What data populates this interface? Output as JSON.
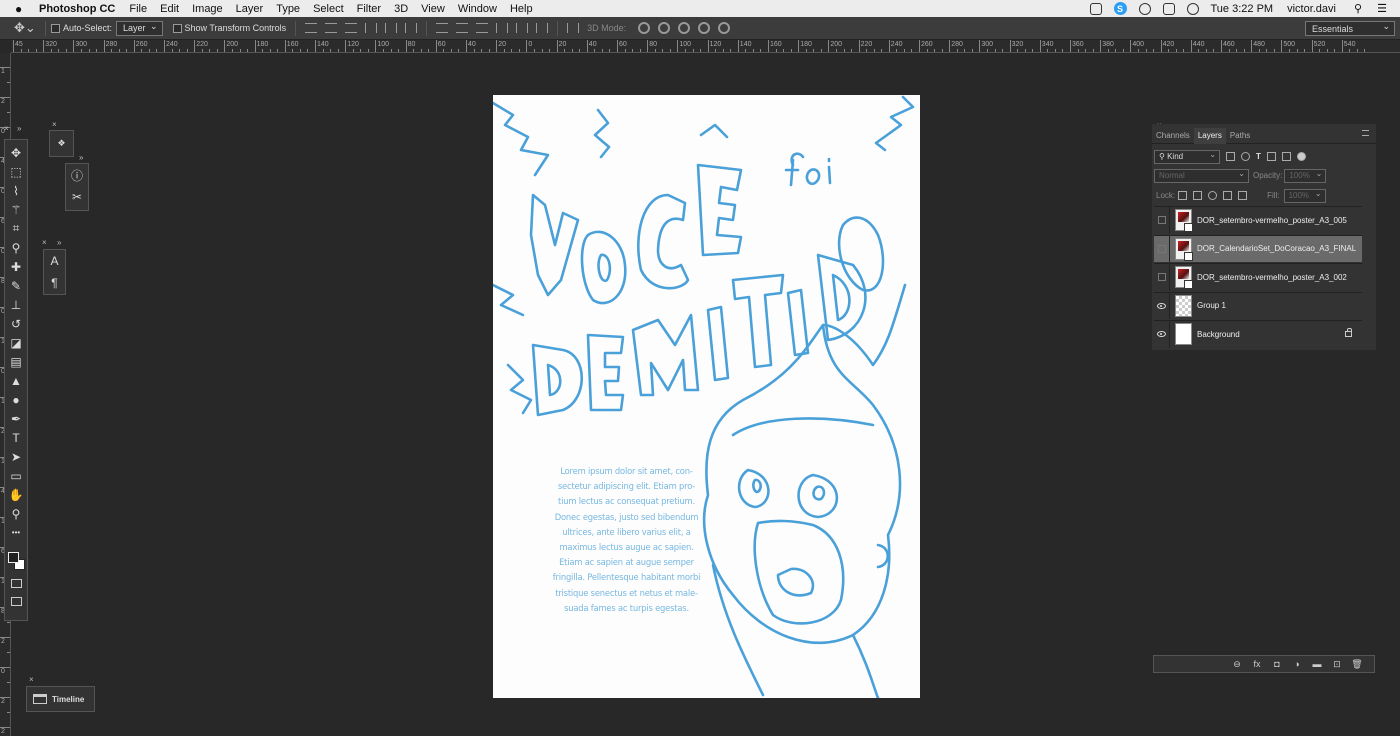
{
  "menubar": {
    "app_name": "Photoshop CC",
    "menus": [
      "File",
      "Edit",
      "Image",
      "Layer",
      "Type",
      "Select",
      "Filter",
      "3D",
      "View",
      "Window",
      "Help"
    ],
    "skype_badge": "S",
    "clock": "Tue 3:22 PM",
    "user": "victor.davi"
  },
  "options": {
    "auto_select_label": "Auto-Select:",
    "auto_select_value": "Layer",
    "show_transform_label": "Show Transform Controls",
    "mode_3d_label": "3D Mode:",
    "workspace": "Essentials"
  },
  "rulers": {
    "top_labels": [
      "45",
      "320",
      "300",
      "280",
      "260",
      "240",
      "220",
      "200",
      "180",
      "160",
      "140",
      "120",
      "100",
      "80",
      "60",
      "40",
      "20",
      "0",
      "20",
      "40",
      "60",
      "80",
      "100",
      "120",
      "140",
      "160",
      "180",
      "200",
      "220",
      "240",
      "260",
      "280",
      "300",
      "320",
      "340",
      "360",
      "380",
      "400",
      "420",
      "440",
      "460",
      "480",
      "500",
      "520",
      "540"
    ],
    "left_labels": [
      "1",
      "2",
      "0",
      "4",
      "0",
      "6",
      "0",
      "8",
      "0",
      "1",
      "0",
      "1",
      "2",
      "1",
      "4",
      "1",
      "6",
      "1",
      "8",
      "2",
      "0",
      "2",
      "2"
    ]
  },
  "tools": [
    {
      "name": "move-tool-icon",
      "glyph": "✥"
    },
    {
      "name": "marquee-tool-icon",
      "glyph": "⬚"
    },
    {
      "name": "lasso-tool-icon",
      "glyph": "⌇"
    },
    {
      "name": "magic-wand-tool-icon",
      "glyph": "⚚"
    },
    {
      "name": "crop-tool-icon",
      "glyph": "⌗"
    },
    {
      "name": "eyedropper-tool-icon",
      "glyph": "⚲"
    },
    {
      "name": "healing-brush-tool-icon",
      "glyph": "✚"
    },
    {
      "name": "brush-tool-icon",
      "glyph": "✎"
    },
    {
      "name": "clone-stamp-tool-icon",
      "glyph": "⊥"
    },
    {
      "name": "history-brush-tool-icon",
      "glyph": "↺"
    },
    {
      "name": "eraser-tool-icon",
      "glyph": "◪"
    },
    {
      "name": "gradient-tool-icon",
      "glyph": "▤"
    },
    {
      "name": "blur-tool-icon",
      "glyph": "▲"
    },
    {
      "name": "dodge-tool-icon",
      "glyph": "●"
    },
    {
      "name": "pen-tool-icon",
      "glyph": "✒"
    },
    {
      "name": "type-tool-icon",
      "glyph": "T"
    },
    {
      "name": "path-selection-tool-icon",
      "glyph": "➤"
    },
    {
      "name": "rectangle-tool-icon",
      "glyph": "▭"
    },
    {
      "name": "hand-tool-icon",
      "glyph": "✋"
    },
    {
      "name": "zoom-tool-icon",
      "glyph": "⚲"
    },
    {
      "name": "more-tools-icon",
      "glyph": "•••"
    }
  ],
  "mini_panels": {
    "character_glyph": "A",
    "paragraph_glyph": "¶",
    "info_glyph": "ⓘ",
    "tool_presets_glyph": "✂"
  },
  "document": {
    "lorem_lines": [
      "Lorem ipsum dolor sit amet, con-",
      "sectetur adipiscing elit. Etiam pro-",
      "tium lectus ac consequat pretium.",
      "Donec egestas, justo sed bibendum",
      "ultrices, ante libero varius elit, a",
      "maximus lectus augue ac sapien.",
      "Etiam ac sapien at augue semper",
      "fringilla. Pellentesque habitant morbi",
      "tristique senectus et netus et male-",
      "suada fames ac turpis egestas."
    ],
    "sketch_color": "#4aa0d8"
  },
  "layers_panel": {
    "tabs": [
      "Channels",
      "Layers",
      "Paths"
    ],
    "active_tab": "Layers",
    "filter_kind": "Kind",
    "blend_mode": "Normal",
    "opacity_label": "Opacity:",
    "opacity_value": "100%",
    "lock_label": "Lock:",
    "fill_label": "Fill:",
    "fill_value": "100%",
    "layers": [
      {
        "name": "DOR_setembro-vermelho_poster_A3_005",
        "visible": false,
        "thumb": "smart",
        "selected": false,
        "locked": false
      },
      {
        "name": "DOR_CalendarioSet_DoCoracao_A3_FINAL",
        "visible": false,
        "thumb": "smart",
        "selected": true,
        "locked": false
      },
      {
        "name": "DOR_setembro-vermelho_poster_A3_002",
        "visible": false,
        "thumb": "smart",
        "selected": false,
        "locked": false
      },
      {
        "name": "Group 1",
        "visible": true,
        "thumb": "checker",
        "selected": false,
        "locked": false
      },
      {
        "name": "Background",
        "visible": true,
        "thumb": "white",
        "selected": false,
        "locked": true
      }
    ],
    "bottom_glyphs": [
      "⊖",
      "fx",
      "◘",
      "◑",
      "▬",
      "⊡",
      "🗑"
    ]
  },
  "timeline": {
    "label": "Timeline"
  }
}
